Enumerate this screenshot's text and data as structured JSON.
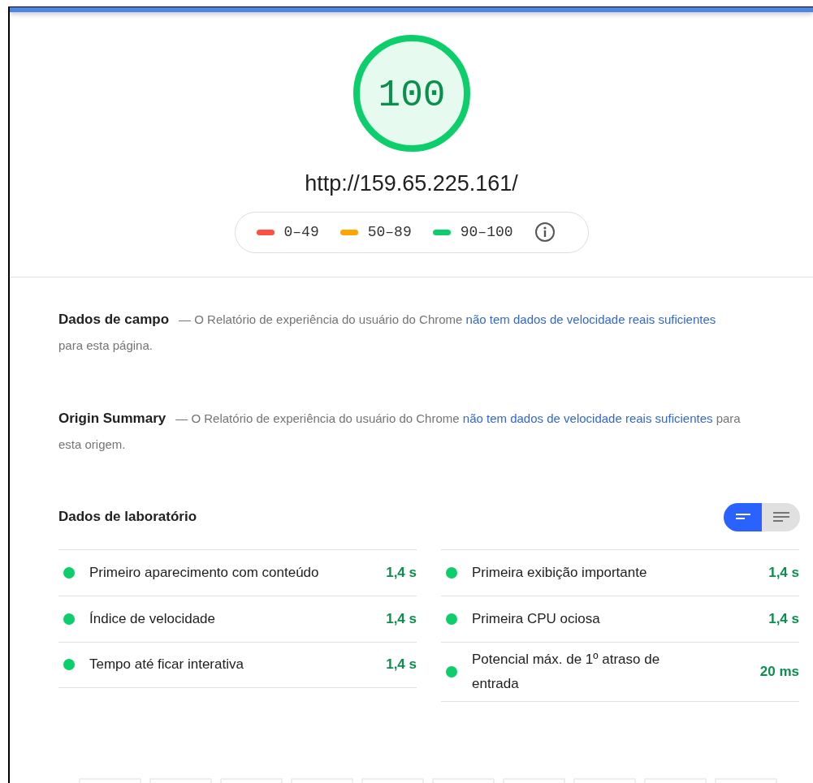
{
  "score": {
    "value": "100",
    "level": 1.0,
    "color": "#0cce6b"
  },
  "url": "http://159.65.225.161/",
  "legend": [
    {
      "label": "0–49",
      "color": "#ff4e42"
    },
    {
      "label": "50–89",
      "color": "#ffa400"
    },
    {
      "label": "90–100",
      "color": "#0cce6b"
    }
  ],
  "sections": [
    {
      "title": "Dados de campo",
      "text": "— O Relatório de experiência do usuário do Chrome ",
      "link": "não tem dados de velocidade reais suficientes",
      "after": " para esta página."
    },
    {
      "title": "Origin Summary",
      "text": "— O Relatório de experiência do usuário do Chrome ",
      "link": "não tem dados de velocidade reais suficientes",
      "after": " para esta origem."
    }
  ],
  "lab": {
    "title": "Dados de laboratório",
    "toggle": [
      {
        "kind": "summary",
        "selected": true
      },
      {
        "kind": "details",
        "selected": false
      }
    ],
    "metrics": [
      {
        "label": "Primeiro aparecimento com conteúdo",
        "value": "1,4 s",
        "color": "#0cce6b"
      },
      {
        "label": "Primeira exibição importante",
        "value": "1,4 s",
        "color": "#0cce6b"
      },
      {
        "label": "Índice de velocidade",
        "value": "1,4 s",
        "color": "#0cce6b"
      },
      {
        "label": "Primeira CPU ociosa",
        "value": "1,4 s",
        "color": "#0cce6b"
      },
      {
        "label": "Tempo até ficar interativa",
        "value": "1,4 s",
        "color": "#0cce6b"
      },
      {
        "label": "Potencial máx. de 1º atraso de entrada",
        "value": "20 ms",
        "color": "#0cce6b"
      }
    ]
  }
}
